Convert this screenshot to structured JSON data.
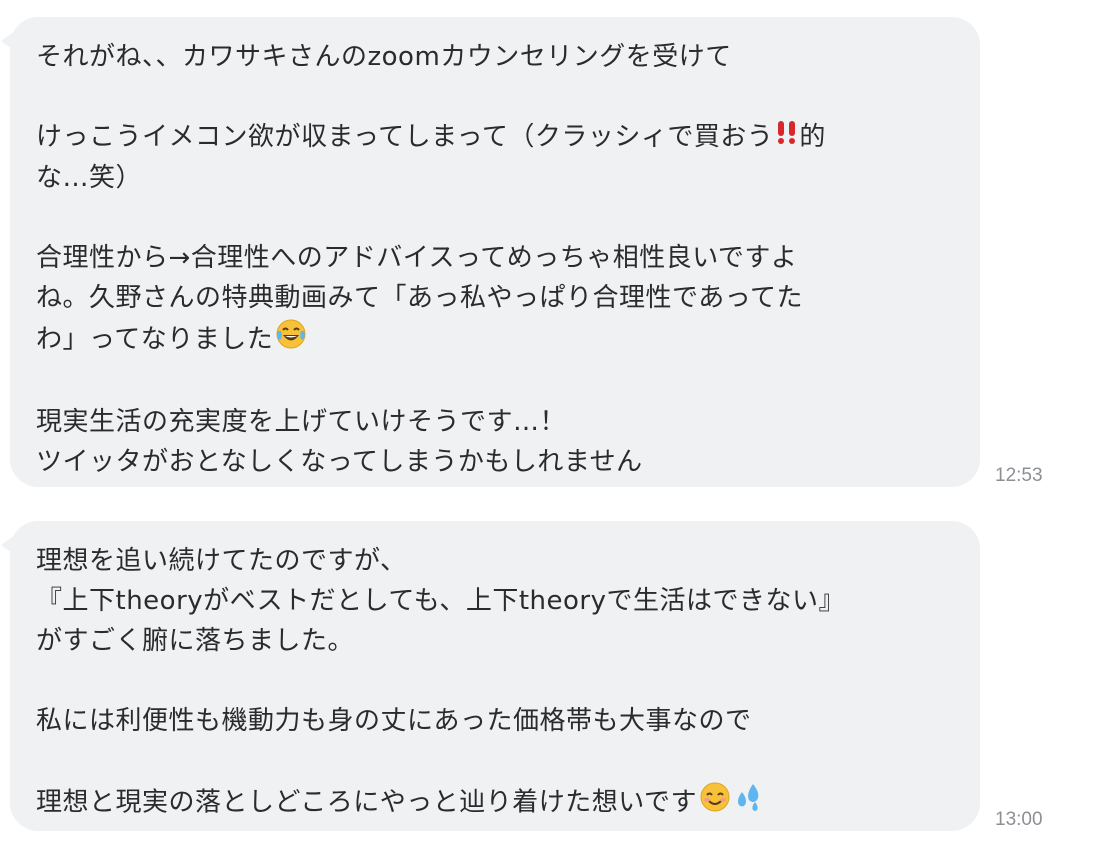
{
  "messages": [
    {
      "lines": [
        "それがね、、カワサキさんのzoomカウンセリングを受けて",
        "",
        "けっこうイメコン欲が収まってしまって（クラッシィで買おう",
        "的",
        "な…笑）",
        "",
        "合理性から→合理性へのアドバイスってめっちゃ相性良いですよ",
        "ね。久野さんの特典動画みて「あっ私やっぱり合理性であってた",
        "わ」ってなりました",
        "",
        "現実生活の充実度を上げていけそうです…！",
        "ツイッタがおとなしくなってしまうかもしれません"
      ],
      "time": "12:53"
    },
    {
      "lines": [
        "理想を追い続けてたのですが、",
        "『上下theoryがベストだとしても、上下theoryで生活はできない』",
        "がすごく腑に落ちました。",
        "",
        "私には利便性も機動力も身の丈にあった価格帯も大事なので",
        "",
        "理想と現実の落としどころにやっと辿り着けた想いです"
      ],
      "time": "13:00"
    }
  ],
  "icons": {
    "exclamation": "double-exclamation-icon",
    "laugh": "tears-of-joy-icon",
    "smile": "smiling-face-icon",
    "sweat": "sweat-droplets-icon"
  },
  "colors": {
    "bubble": "#f0f1f3",
    "text": "#2b2b2b",
    "timestamp": "#8c8f94",
    "exclamation": "#d8282b"
  }
}
